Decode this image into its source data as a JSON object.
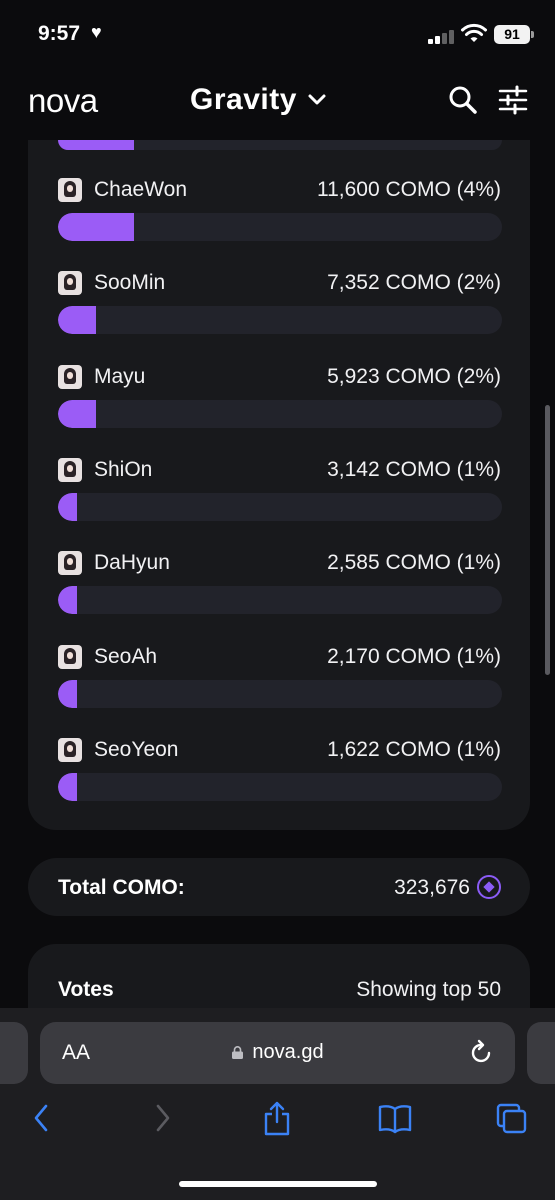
{
  "status_bar": {
    "time": "9:57",
    "battery": "91"
  },
  "header": {
    "logo": "nova",
    "title": "Gravity"
  },
  "members": [
    {
      "name": "ChaeWon",
      "value": "11,600 COMO (4%)",
      "fraction": 0.04
    },
    {
      "name": "SooMin",
      "value": "7,352 COMO (2%)",
      "fraction": 0.02
    },
    {
      "name": "Mayu",
      "value": "5,923 COMO (2%)",
      "fraction": 0.02
    },
    {
      "name": "ShiOn",
      "value": "3,142 COMO (1%)",
      "fraction": 0.01
    },
    {
      "name": "DaHyun",
      "value": "2,585 COMO (1%)",
      "fraction": 0.01
    },
    {
      "name": "SeoAh",
      "value": "2,170 COMO (1%)",
      "fraction": 0.01
    },
    {
      "name": "SeoYeon",
      "value": "1,622 COMO (1%)",
      "fraction": 0.01
    }
  ],
  "partial_top_fraction": 0.04,
  "total": {
    "label": "Total COMO:",
    "value": "323,676"
  },
  "votes": {
    "label": "Votes",
    "subtitle": "Showing top 50"
  },
  "browser": {
    "text_size_label": "AA",
    "url": "nova.gd"
  },
  "colors": {
    "accent": "#9b5cf6",
    "panel": "#18191c",
    "track": "#22232b",
    "background": "#0b0b0d"
  },
  "icons": {
    "header": [
      "search-icon",
      "sliders-icon",
      "chevron-down-icon"
    ],
    "toolbar": [
      "back-icon",
      "forward-icon",
      "share-icon",
      "bookmarks-icon",
      "tabs-icon"
    ]
  }
}
